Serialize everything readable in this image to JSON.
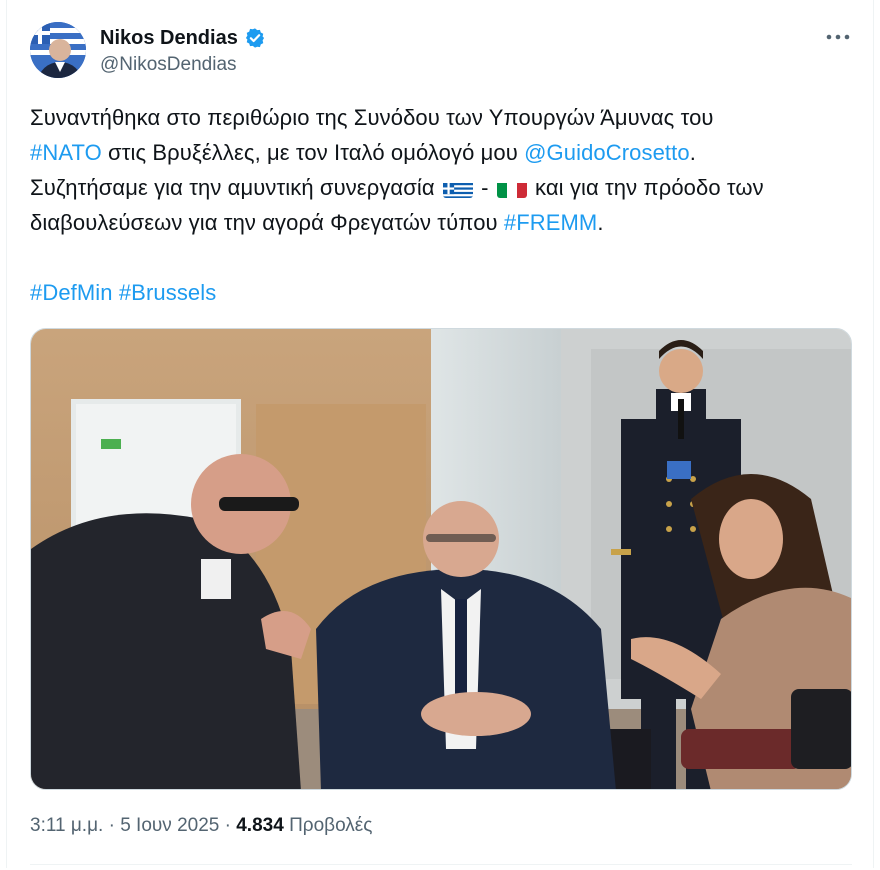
{
  "author": {
    "name": "Nikos Dendias",
    "handle": "@NikosDendias",
    "verified": true,
    "avatar_icon": "profile-photo"
  },
  "more_icon": "more-horizontal-icon",
  "tweet": {
    "line1": "Συναντήθηκα στο περιθώριο της Συνόδου των Υπουργών Άμυνας του",
    "line2": {
      "link_nato": "#NATO",
      "text_a": " στις Βρυξέλλες, με τον Ιταλό ομόλογό μου ",
      "link_mention": "@GuidoCrosetto",
      "text_b": "."
    },
    "line3": {
      "text_a": "Συζητήσαμε για την αμυντική συνεργασία ",
      "flag_greece": "greece-flag-emoji",
      "dash": " - ",
      "flag_italy": "italy-flag-emoji",
      "text_b": " και για την πρόοδο των"
    },
    "line4": {
      "text_a": "διαβουλεύσεων για την αγορά Φρεγατών τύπου ",
      "link_fremm": "#FREMM",
      "text_b": "."
    },
    "hashtags": {
      "defmin": "#DefMin",
      "brussels": "#Brussels"
    }
  },
  "media": {
    "type": "photo"
  },
  "meta": {
    "time": "3:11 μ.μ.",
    "separator": " · ",
    "date": "5 Ιουν 2025",
    "dot": " · ",
    "views_count": "4.834",
    "views_label": "Προβολές"
  },
  "colors": {
    "link": "#1d9bf0",
    "verified": "#1d9bf0",
    "secondary_text": "#536471"
  }
}
